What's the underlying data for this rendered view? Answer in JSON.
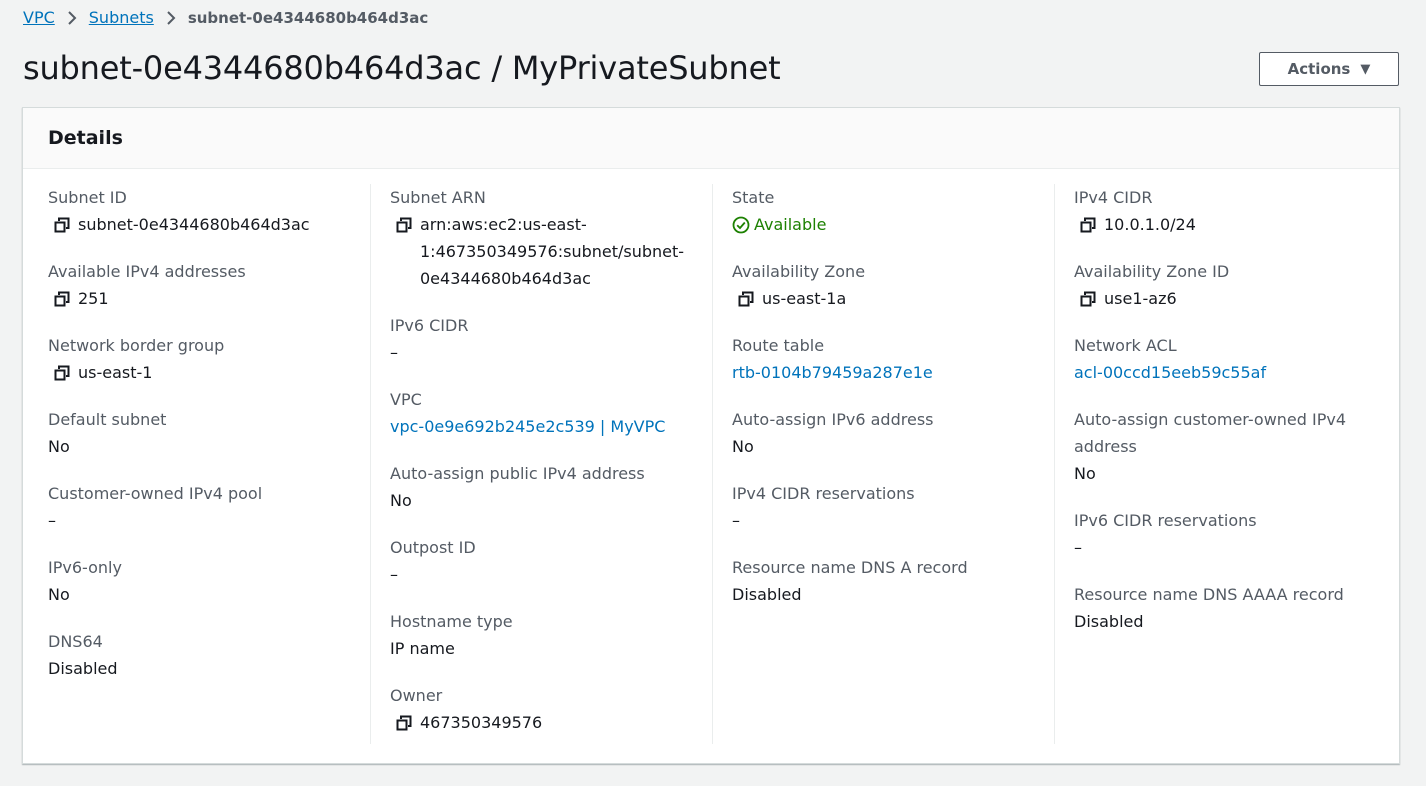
{
  "breadcrumb": {
    "items": [
      "VPC",
      "Subnets"
    ],
    "current": "subnet-0e4344680b464d3ac"
  },
  "page": {
    "title": "subnet-0e4344680b464d3ac / MyPrivateSubnet",
    "actions_label": "Actions"
  },
  "details": {
    "heading": "Details",
    "col1": [
      {
        "label": "Subnet ID",
        "value": "subnet-0e4344680b464d3ac",
        "copy": true
      },
      {
        "label": "Available IPv4 addresses",
        "value": "251",
        "copy": true
      },
      {
        "label": "Network border group",
        "value": "us-east-1",
        "copy": true
      },
      {
        "label": "Default subnet",
        "value": "No"
      },
      {
        "label": "Customer-owned IPv4 pool",
        "value": "–"
      },
      {
        "label": "IPv6-only",
        "value": "No"
      },
      {
        "label": "DNS64",
        "value": "Disabled"
      }
    ],
    "col2": [
      {
        "label": "Subnet ARN",
        "value": "arn:aws:ec2:us-east-1:467350349576:subnet/subnet-0e4344680b464d3ac",
        "copy": true
      },
      {
        "label": "IPv6 CIDR",
        "value": "–"
      },
      {
        "label": "VPC",
        "value": "vpc-0e9e692b245e2c539 | MyVPC",
        "link": true
      },
      {
        "label": "Auto-assign public IPv4 address",
        "value": "No"
      },
      {
        "label": "Outpost ID",
        "value": "–"
      },
      {
        "label": "Hostname type",
        "value": "IP name"
      },
      {
        "label": "Owner",
        "value": "467350349576",
        "copy": true
      }
    ],
    "col3": [
      {
        "label": "State",
        "value": "Available",
        "status": "ok"
      },
      {
        "label": "Availability Zone",
        "value": "us-east-1a",
        "copy": true
      },
      {
        "label": "Route table",
        "value": "rtb-0104b79459a287e1e",
        "link": true
      },
      {
        "label": "Auto-assign IPv6 address",
        "value": "No"
      },
      {
        "label": "IPv4 CIDR reservations",
        "value": "–"
      },
      {
        "label": "Resource name DNS A record",
        "value": "Disabled"
      }
    ],
    "col4": [
      {
        "label": "IPv4 CIDR",
        "value": "10.0.1.0/24",
        "copy": true
      },
      {
        "label": "Availability Zone ID",
        "value": "use1-az6",
        "copy": true
      },
      {
        "label": "Network ACL",
        "value": "acl-00ccd15eeb59c55af",
        "link": true
      },
      {
        "label": "Auto-assign customer-owned IPv4 address",
        "value": "No"
      },
      {
        "label": "IPv6 CIDR reservations",
        "value": "–"
      },
      {
        "label": "Resource name DNS AAAA record",
        "value": "Disabled"
      }
    ]
  },
  "colors": {
    "link": "#0073bb",
    "success": "#1d8102",
    "label": "#545b64"
  },
  "icons": {
    "copy": "copy-icon",
    "status": "status-available-icon",
    "breadcrumb_separator": "chevron-right-icon",
    "actions_caret": "caret-down-icon"
  }
}
